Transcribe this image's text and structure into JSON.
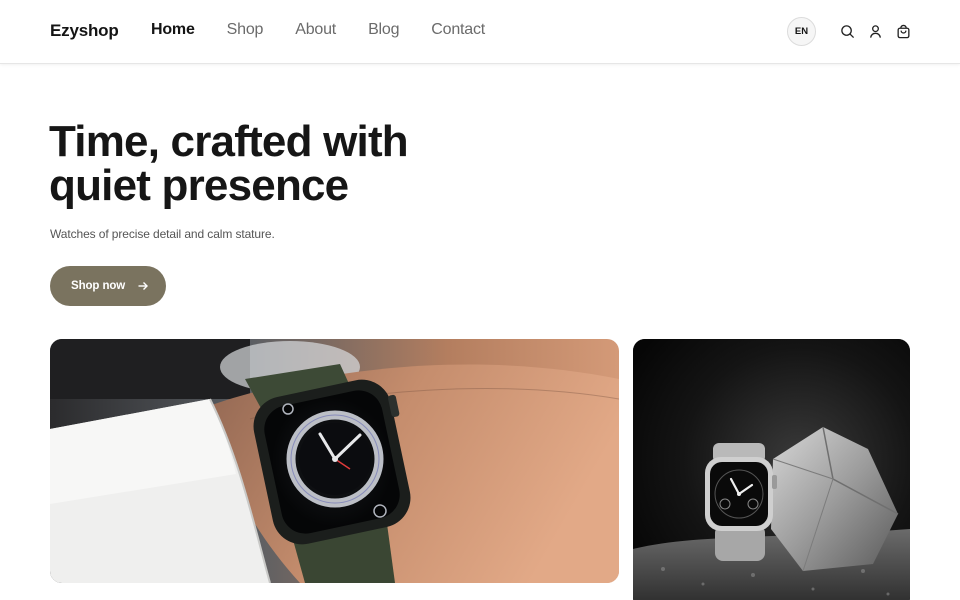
{
  "header": {
    "brand": "Ezyshop",
    "nav": [
      {
        "label": "Home",
        "active": true
      },
      {
        "label": "Shop",
        "active": false
      },
      {
        "label": "About",
        "active": false
      },
      {
        "label": "Blog",
        "active": false
      },
      {
        "label": "Contact",
        "active": false
      }
    ],
    "language": "EN",
    "icons": [
      "search-icon",
      "user-icon",
      "cart-icon"
    ]
  },
  "hero": {
    "title_line1": "Time, crafted with",
    "title_line2": "quiet presence",
    "subtitle": "Watches of precise detail and calm stature.",
    "cta_label": "Shop now",
    "cta_color": "#7a735f"
  },
  "images": {
    "main": "smartwatch-on-wrist-photo",
    "side": "smartwatch-with-rock-photo"
  }
}
